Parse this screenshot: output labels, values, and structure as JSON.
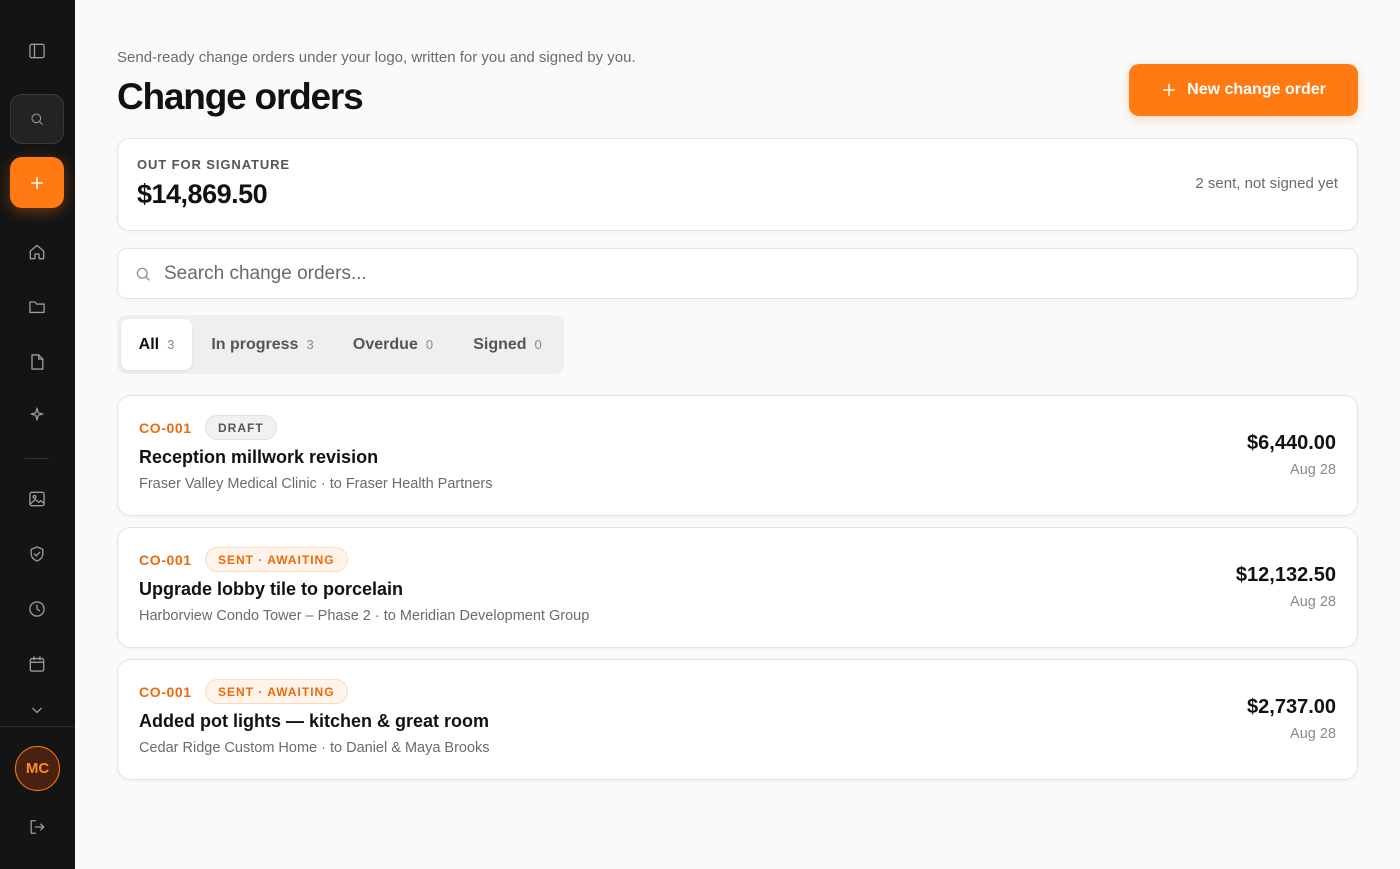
{
  "sidebar": {
    "items": [
      {
        "name": "sidebar-toggle",
        "icon": "sidebar-panel-icon"
      },
      {
        "name": "search",
        "icon": "search-icon"
      },
      {
        "name": "create",
        "icon": "plus-icon"
      },
      {
        "name": "home",
        "icon": "home-icon"
      },
      {
        "name": "projects",
        "icon": "folder-icon"
      },
      {
        "name": "documents",
        "icon": "file-icon"
      },
      {
        "name": "ai",
        "icon": "sparkle-icon"
      },
      {
        "name": "photos",
        "icon": "image-icon"
      },
      {
        "name": "warranty",
        "icon": "shield-check-icon"
      },
      {
        "name": "history",
        "icon": "clock-icon"
      },
      {
        "name": "calendar",
        "icon": "calendar-icon"
      },
      {
        "name": "more",
        "icon": "chevron-down-icon"
      },
      {
        "name": "logout",
        "icon": "logout-icon"
      }
    ],
    "avatar_initials": "MC"
  },
  "header": {
    "subtitle": "Send-ready change orders under your logo, written for you and signed by you.",
    "title": "Change orders",
    "new_button_label": "New change order"
  },
  "summary": {
    "label": "OUT FOR SIGNATURE",
    "amount": "$14,869.50",
    "note": "2 sent, not signed yet"
  },
  "search": {
    "placeholder": "Search change orders..."
  },
  "tabs": [
    {
      "label": "All",
      "count": "3",
      "active": true
    },
    {
      "label": "In progress",
      "count": "3",
      "active": false
    },
    {
      "label": "Overdue",
      "count": "0",
      "active": false
    },
    {
      "label": "Signed",
      "count": "0",
      "active": false
    }
  ],
  "change_orders": [
    {
      "id": "CO-001",
      "status": "DRAFT",
      "title": "Reception millwork revision",
      "subtitle": "Fraser Valley Medical Clinic · to Fraser Health Partners",
      "amount": "$6,440.00",
      "date": "Aug 28"
    },
    {
      "id": "CO-001",
      "status": "SENT · AWAITING",
      "title": "Upgrade lobby tile to porcelain",
      "subtitle": "Harborview Condo Tower – Phase 2 · to Meridian Development Group",
      "amount": "$12,132.50",
      "date": "Aug 28"
    },
    {
      "id": "CO-001",
      "status": "SENT · AWAITING",
      "title": "Added pot lights — kitchen & great room",
      "subtitle": "Cedar Ridge Custom Home · to Daniel & Maya Brooks",
      "amount": "$2,737.00",
      "date": "Aug 28"
    }
  ],
  "colors": {
    "accent": "#ff7a12",
    "sidebar_bg": "#141414",
    "page_bg": "#fafafa"
  }
}
